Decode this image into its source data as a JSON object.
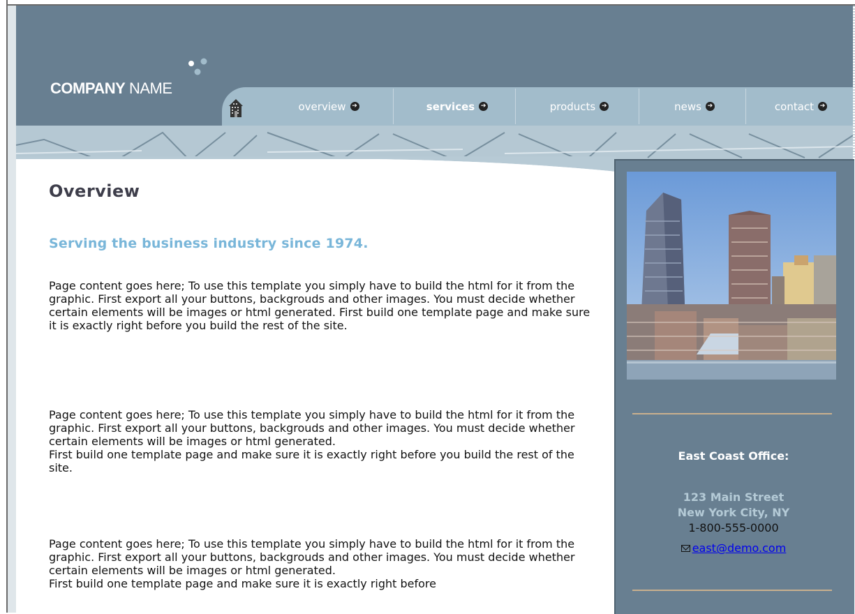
{
  "brand": {
    "name_bold": "COMPANY",
    "name_rest": "NAME"
  },
  "nav": {
    "items": [
      {
        "label": "overview",
        "active": false
      },
      {
        "label": "services",
        "active": true
      },
      {
        "label": "products",
        "active": false
      },
      {
        "label": "news",
        "active": false
      },
      {
        "label": "contact",
        "active": false
      }
    ]
  },
  "main": {
    "title": "Overview",
    "subtitle": "Serving the business industry since 1974.",
    "paragraphs": [
      "Page content goes here; To use this template you simply have to build the html for it from the graphic. First export all your buttons, backgrouds and other images. You must decide whether certain elements will be images or html generated. First build one template page and make sure it is exactly right before you build the rest of the site.",
      "Page content goes here; To use this template you simply have to build the html for it from the graphic. First export all your buttons, backgrouds and other images. You must decide whether certain elements will be images or html generated.\nFirst build one template page and make sure it is exactly right before you build the rest of the site.",
      "Page content goes here; To use this template you simply have to build the html for it from the graphic. First export all your buttons, backgrouds and other images. You must decide whether certain elements will be images or html generated.\nFirst build one template page and make sure it is exactly right before"
    ]
  },
  "sidebar": {
    "office_title": "East Coast Office:",
    "street": "123 Main Street",
    "city": "New York City, NY",
    "phone": "1-800-555-0000",
    "email": "east@demo.com"
  },
  "colors": {
    "header": "#687f91",
    "nav": "#a2bccb",
    "subtitle": "#79b6d9",
    "divider": "#c9b08e"
  }
}
